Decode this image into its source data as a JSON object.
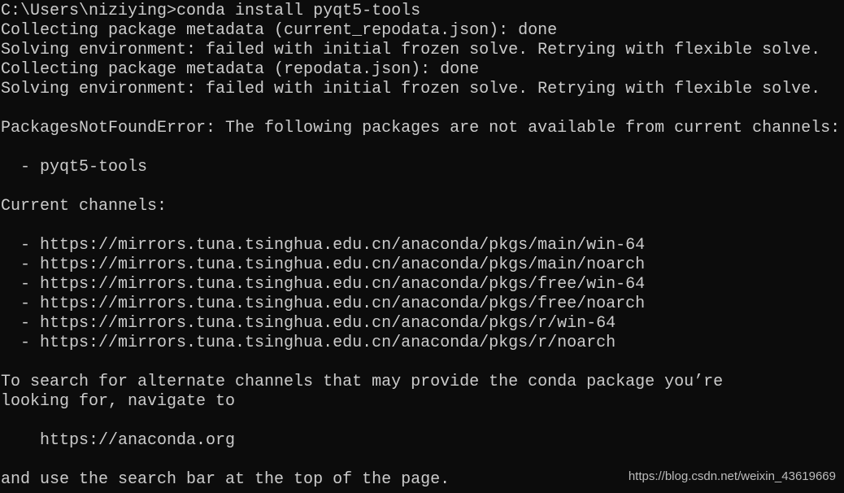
{
  "terminal": {
    "lines": [
      "C:\\Users\\niziying>conda install pyqt5-tools",
      "Collecting package metadata (current_repodata.json): done",
      "Solving environment: failed with initial frozen solve. Retrying with flexible solve.",
      "Collecting package metadata (repodata.json): done",
      "Solving environment: failed with initial frozen solve. Retrying with flexible solve.",
      "",
      "PackagesNotFoundError: The following packages are not available from current channels:",
      "",
      "  - pyqt5-tools",
      "",
      "Current channels:",
      "",
      "  - https://mirrors.tuna.tsinghua.edu.cn/anaconda/pkgs/main/win-64",
      "  - https://mirrors.tuna.tsinghua.edu.cn/anaconda/pkgs/main/noarch",
      "  - https://mirrors.tuna.tsinghua.edu.cn/anaconda/pkgs/free/win-64",
      "  - https://mirrors.tuna.tsinghua.edu.cn/anaconda/pkgs/free/noarch",
      "  - https://mirrors.tuna.tsinghua.edu.cn/anaconda/pkgs/r/win-64",
      "  - https://mirrors.tuna.tsinghua.edu.cn/anaconda/pkgs/r/noarch",
      "",
      "To search for alternate channels that may provide the conda package you’re",
      "looking for, navigate to",
      "",
      "    https://anaconda.org",
      "",
      "and use the search bar at the top of the page."
    ]
  },
  "watermark": "https://blog.csdn.net/weixin_43619669",
  "colors": {
    "background": "#0c0c0c",
    "text": "#cccccc"
  }
}
